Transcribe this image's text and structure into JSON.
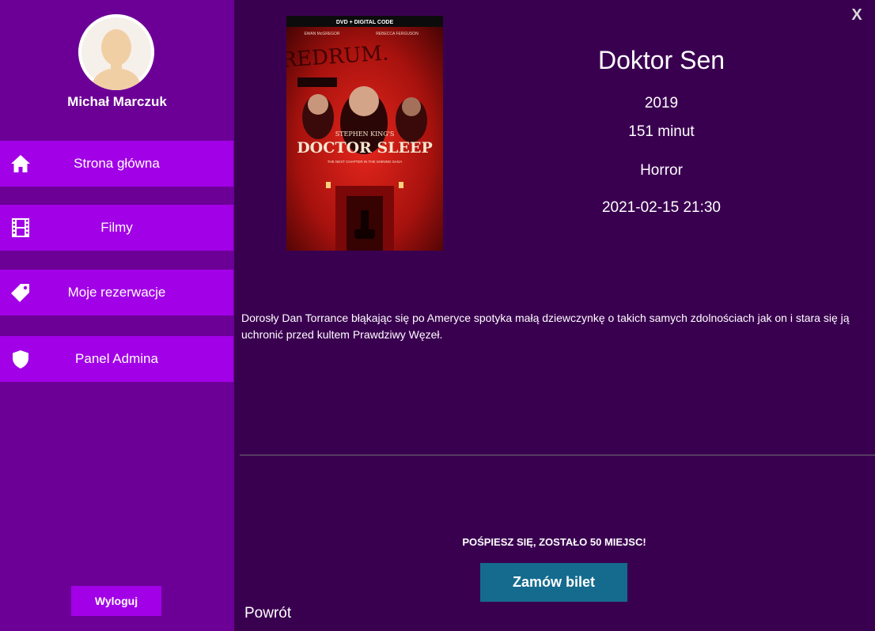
{
  "user": {
    "name": "Michał Marczuk"
  },
  "sidebar": {
    "items": [
      {
        "label": "Strona główna",
        "icon": "home-icon"
      },
      {
        "label": "Filmy",
        "icon": "film-icon"
      },
      {
        "label": "Moje rezerwacje",
        "icon": "tag-icon"
      },
      {
        "label": "Panel Admina",
        "icon": "shield-icon"
      }
    ],
    "logout_label": "Wyloguj"
  },
  "window": {
    "close_label": "X"
  },
  "poster": {
    "top_text": "DVD + DIGITAL CODE",
    "cast_left": "EWAN McGREGOR",
    "cast_right": "REBECCA FERGUSON",
    "graffiti": "REDRUM.",
    "subtitle": "STEPHEN KING'S",
    "title": "DOCTOR SLEEP",
    "tagline": "THE NEXT CHAPTER IN THE SHINING SAGA"
  },
  "movie": {
    "title": "Doktor Sen",
    "year": "2019",
    "duration": "151 minut",
    "genre": "Horror",
    "datetime": "2021-02-15 21:30",
    "description": "Dorosły Dan Torrance błąkając się po Ameryce spotyka małą dziewczynkę o takich samych zdolnościach jak on i stara się ją uchronić przed kultem Prawdziwy Węzeł."
  },
  "booking": {
    "seats_warning": "POŚPIESZ SIĘ, ZOSTAŁO 50 MIEJSC!",
    "order_label": "Zamów bilet"
  },
  "back_label": "Powrót",
  "colors": {
    "sidebar_bg": "#6c0096",
    "nav_item_bg": "#a200e6",
    "main_bg": "#3a0050",
    "order_button_bg": "#146b8e"
  }
}
